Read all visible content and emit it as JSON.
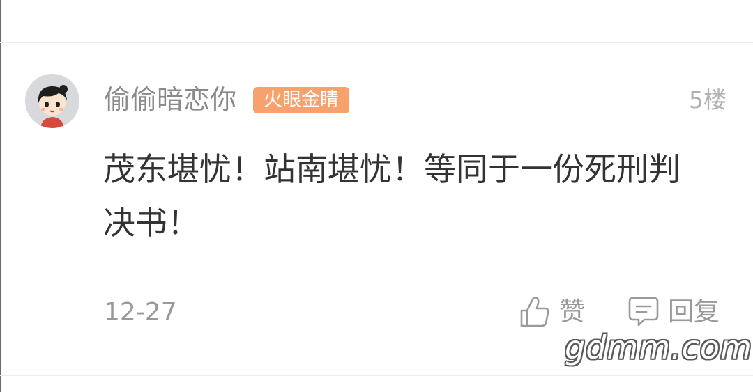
{
  "comment": {
    "username": "偷偷暗恋你",
    "badge": "火眼金睛",
    "floor": "5楼",
    "text": "茂东堪忧！站南堪忧！等同于一份死刑判决书！",
    "date": "12-27",
    "like_label": "赞",
    "reply_label": "回复"
  },
  "watermark": "gdmm.com",
  "icons": {
    "avatar": "cartoon-avatar",
    "like": "thumbs-up-icon",
    "reply": "comment-bubble-icon"
  },
  "colors": {
    "badge": "#f7a26d",
    "username": "#8a8a8a",
    "content": "#333333",
    "meta": "#999999",
    "divider": "#ececec"
  }
}
